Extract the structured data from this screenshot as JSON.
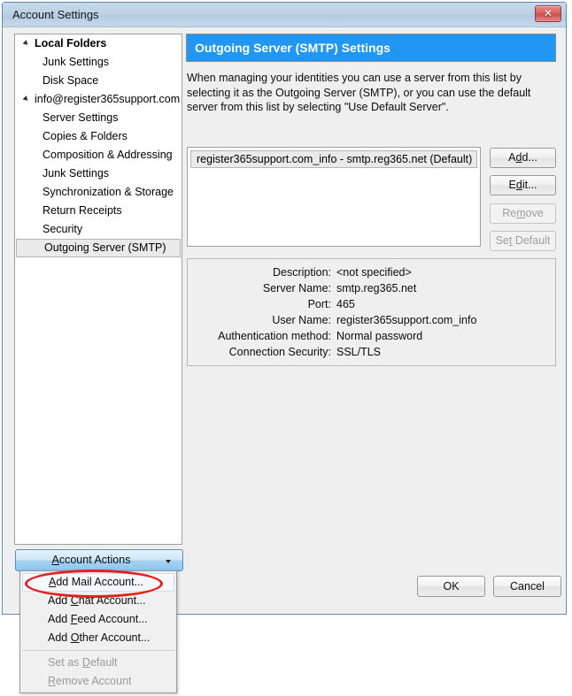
{
  "window": {
    "title": "Account Settings",
    "close_label": "✕"
  },
  "sidebar": {
    "items": [
      {
        "label": "Local Folders",
        "type": "root"
      },
      {
        "label": "Junk Settings",
        "type": "child"
      },
      {
        "label": "Disk Space",
        "type": "child"
      },
      {
        "label": "info@register365support.com",
        "type": "account"
      },
      {
        "label": "Server Settings",
        "type": "child"
      },
      {
        "label": "Copies & Folders",
        "type": "child"
      },
      {
        "label": "Composition & Addressing",
        "type": "child"
      },
      {
        "label": "Junk Settings",
        "type": "child"
      },
      {
        "label": "Synchronization & Storage",
        "type": "child"
      },
      {
        "label": "Return Receipts",
        "type": "child"
      },
      {
        "label": "Security",
        "type": "child"
      },
      {
        "label": "Outgoing Server (SMTP)",
        "type": "child",
        "selected": true
      }
    ],
    "account_actions": {
      "label_before": "A",
      "label_accel": "A",
      "label": "Account Actions"
    }
  },
  "actions_menu": {
    "items": [
      {
        "label": "Add Mail Account...",
        "accel": "A",
        "state": "highlight"
      },
      {
        "label": "Add Chat Account...",
        "accel": "C",
        "state": "normal"
      },
      {
        "label": "Add Feed Account...",
        "accel": "F",
        "state": "normal"
      },
      {
        "label": "Add Other Account...",
        "accel": "O",
        "state": "normal"
      },
      {
        "label": "separator",
        "state": "separator"
      },
      {
        "label": "Set as Default",
        "accel": "D",
        "state": "disabled"
      },
      {
        "label": "Remove Account",
        "accel": "R",
        "state": "disabled"
      }
    ]
  },
  "panel": {
    "header": "Outgoing Server (SMTP) Settings",
    "description": "When managing your identities you can use a server from this list by selecting it as the Outgoing Server (SMTP), or you can use the default server from this list by selecting \"Use Default Server\".",
    "server_list": [
      {
        "label": "register365support.com_info - smtp.reg365.net (Default)",
        "selected": true
      }
    ],
    "side_buttons": [
      {
        "label": "Add...",
        "accel": "d",
        "enabled": true
      },
      {
        "label": "Edit...",
        "accel": "d",
        "enabled": true
      },
      {
        "label": "Remove",
        "accel": "m",
        "enabled": false
      },
      {
        "label": "Set Default",
        "accel": "t",
        "enabled": false
      }
    ],
    "details": [
      {
        "label": "Description:",
        "value": "<not specified>"
      },
      {
        "label": "Server Name:",
        "value": "smtp.reg365.net"
      },
      {
        "label": "Port:",
        "value": "465"
      },
      {
        "label": "User Name:",
        "value": "register365support.com_info"
      },
      {
        "label": "Authentication method:",
        "value": "Normal password"
      },
      {
        "label": "Connection Security:",
        "value": "SSL/TLS"
      }
    ]
  },
  "footer": {
    "ok_label": "OK",
    "cancel_label": "Cancel"
  },
  "colors": {
    "header_blue": "#2196f3",
    "annotation_red": "#e41f1f",
    "titlebar_blue": "#bed2e6"
  }
}
